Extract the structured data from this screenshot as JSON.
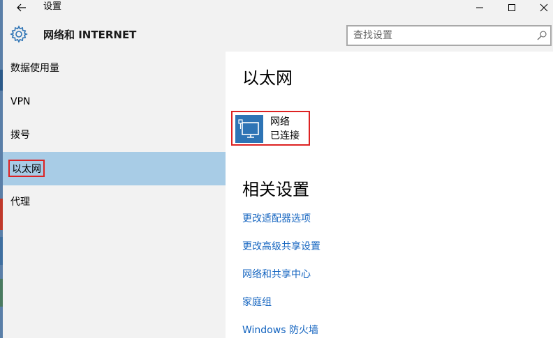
{
  "window": {
    "title": "设置",
    "back_icon": "back-arrow-icon",
    "controls": [
      "minimize-icon",
      "maximize-icon",
      "close-icon"
    ]
  },
  "header": {
    "icon": "gear-icon",
    "section_title": "网络和 INTERNET",
    "search_placeholder": "查找设置",
    "search_icon": "search-icon"
  },
  "sidebar": {
    "items": [
      {
        "label": "数据使用量",
        "active": false
      },
      {
        "label": "VPN",
        "active": false
      },
      {
        "label": "拨号",
        "active": false
      },
      {
        "label": "以太网",
        "active": true
      },
      {
        "label": "代理",
        "active": false
      }
    ]
  },
  "main": {
    "title": "以太网",
    "network": {
      "icon": "monitor-network-icon",
      "name": "网络",
      "status": "已连接"
    },
    "related_title": "相关设置",
    "links": [
      "更改适配器选项",
      "更改高级共享设置",
      "网络和共享中心",
      "家庭组",
      "Windows 防火墙"
    ]
  },
  "colors": {
    "accent": "#2e74b5",
    "link": "#1565c0",
    "selected": "#a8cce6",
    "highlight_box": "#dd2222",
    "chrome_bg": "#f2f2f2"
  }
}
